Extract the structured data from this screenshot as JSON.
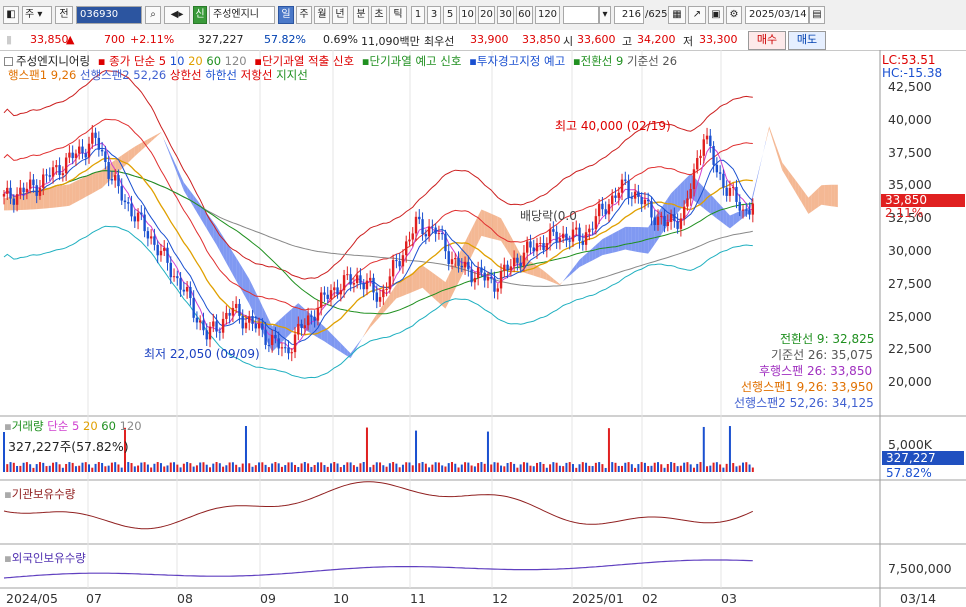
{
  "toolbar": {
    "type_label": "주",
    "period_label": "전",
    "code": "036930",
    "signal_label": "신",
    "stock_name": "주성엔지니",
    "periods": [
      "일",
      "주",
      "월",
      "년",
      "분",
      "초",
      "틱"
    ],
    "minutes": [
      "1",
      "3",
      "5",
      "10",
      "20",
      "30",
      "60",
      "120"
    ],
    "count": "216",
    "count_total": "/625",
    "date": "2025/03/14"
  },
  "pricebar": {
    "price": "33,850",
    "change": "700",
    "change_pct": "+2.11%",
    "volume": "327,227",
    "vol_ratio": "57.82%",
    "turnover": "0.69%",
    "amount": "11,090백만",
    "best_ask_label": "최우선",
    "best_ask": "33,900",
    "best_bid": "33,850",
    "open_label": "시",
    "open": "33,600",
    "high_label": "고",
    "high": "34,200",
    "low_label": "저",
    "low": "33,300",
    "buy_label": "매수",
    "sell_label": "매도"
  },
  "main_legend": {
    "name": "주성엔지니어링",
    "price_ma": "종가 단순 5",
    "ma10": "10",
    "ma20": "20",
    "ma60": "60",
    "ma120": "120",
    "sig1": "단기과열 적출 신호",
    "sig2": "단기과열 예고 신호",
    "sig3": "투자경고지정 예고",
    "ichimoku": "전환선 9",
    "kijun": "기준선 26",
    "lead1": "행스팬1 9,26",
    "lead2": "선행스팬2 52,26",
    "upper": "상한선",
    "lower": "하한선",
    "resist": "저항선",
    "support": "지지선"
  },
  "annotations": {
    "high": "최고 40,000 (02/19)",
    "low": "최저 22,050 (09/09)",
    "dividend": "배당락(0.0"
  },
  "ichimoku_values": {
    "tenkan": "전환선 9: 32,825",
    "kijun": "기준선 26: 35,075",
    "chikou": "후행스팬 26: 33,850",
    "span1": "선행스팬1 9,26: 33,950",
    "span2": "선행스팬2 52,26: 34,125"
  },
  "right_axis": {
    "lc": "LC:53.51",
    "hc": "HC:-15.38",
    "ticks": [
      "42,500",
      "40,000",
      "37,500",
      "35,000",
      "32,500",
      "30,000",
      "27,500",
      "25,000",
      "22,500",
      "20,000"
    ],
    "current_price": "33,850",
    "current_pct": "2.11%",
    "vol_tick": "5,000K",
    "vol_current": "327,227",
    "vol_pct": "57.82%",
    "foreign_tick": "7,500,000"
  },
  "volume_legend": {
    "title": "거래량",
    "ma": "단순 5",
    "ma20": "20",
    "ma60": "60",
    "ma120": "120",
    "value": "327,227주(57.82%)"
  },
  "inst_legend": {
    "title": "기관보유수량"
  },
  "foreign_legend": {
    "title": "외국인보유수량"
  },
  "x_axis": [
    "2024/05",
    "07",
    "08",
    "09",
    "10",
    "11",
    "12",
    "2025/01",
    "02",
    "03"
  ],
  "x_axis_right": "03/14",
  "colors": {
    "up": "#e02020",
    "down": "#1a50d0",
    "cloud_blue": "#5577ee",
    "cloud_orange": "#f0a070"
  }
}
